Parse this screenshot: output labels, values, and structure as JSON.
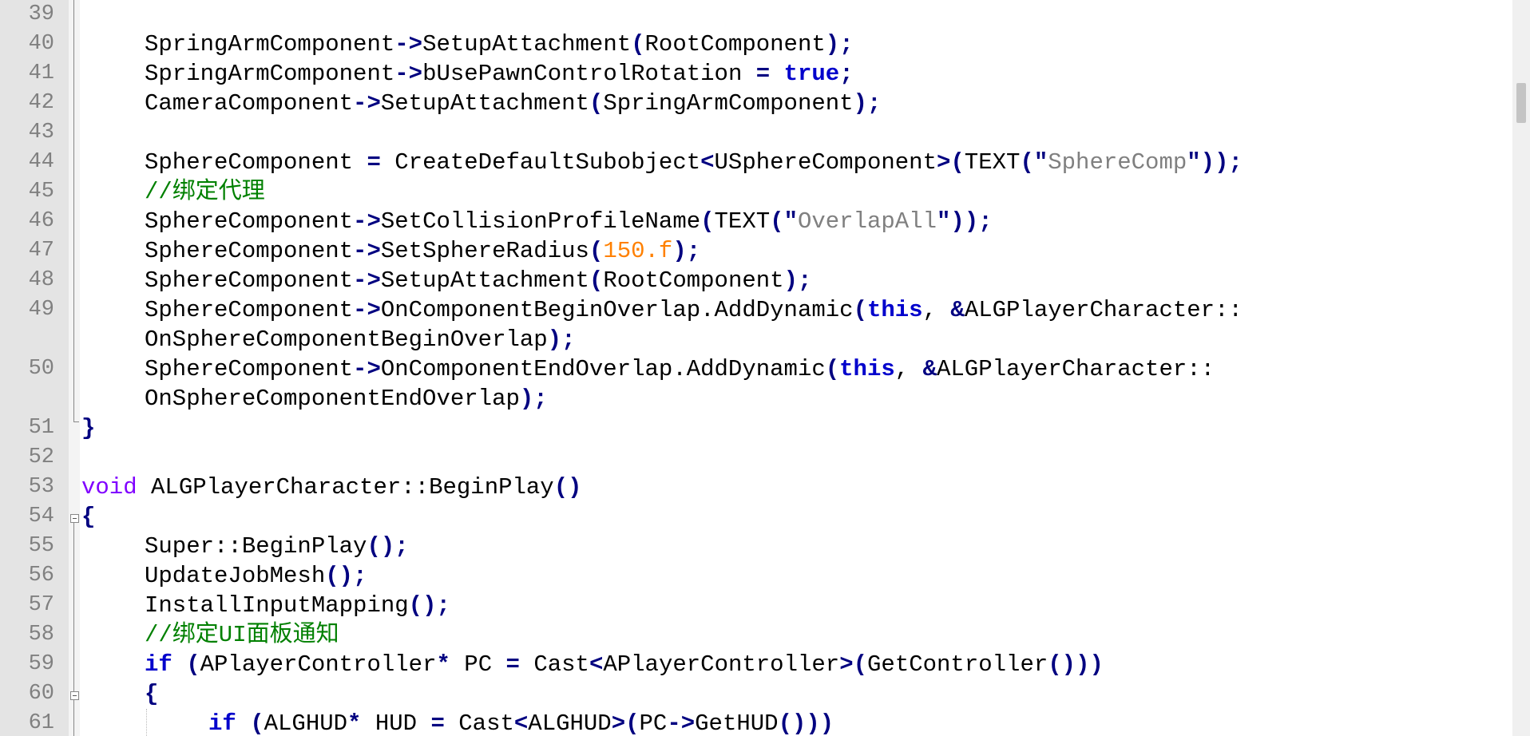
{
  "editor": {
    "lines": [
      {
        "n": "39",
        "text": ""
      },
      {
        "n": "40",
        "text": "SpringArmComponent->SetupAttachment(RootComponent);"
      },
      {
        "n": "41",
        "text": "SpringArmComponent->bUsePawnControlRotation = true;"
      },
      {
        "n": "42",
        "text": "CameraComponent->SetupAttachment(SpringArmComponent);"
      },
      {
        "n": "43",
        "text": ""
      },
      {
        "n": "44",
        "text": "SphereComponent = CreateDefaultSubobject<USphereComponent>(TEXT(\"SphereComp\"));"
      },
      {
        "n": "45",
        "text": "//绑定代理"
      },
      {
        "n": "46",
        "text": "SphereComponent->SetCollisionProfileName(TEXT(\"OverlapAll\"));"
      },
      {
        "n": "47",
        "text": "SphereComponent->SetSphereRadius(150.f);"
      },
      {
        "n": "48",
        "text": "SphereComponent->SetupAttachment(RootComponent);"
      },
      {
        "n": "49",
        "text": "SphereComponent->OnComponentBeginOverlap.AddDynamic(this, &ALGPlayerCharacter::"
      },
      {
        "n": "",
        "text": "OnSphereComponentBeginOverlap);"
      },
      {
        "n": "50",
        "text": "SphereComponent->OnComponentEndOverlap.AddDynamic(this, &ALGPlayerCharacter::"
      },
      {
        "n": "",
        "text": "OnSphereComponentEndOverlap);"
      },
      {
        "n": "51",
        "text": "}"
      },
      {
        "n": "52",
        "text": ""
      },
      {
        "n": "53",
        "text": "void ALGPlayerCharacter::BeginPlay()"
      },
      {
        "n": "54",
        "text": "{"
      },
      {
        "n": "55",
        "text": "Super::BeginPlay();"
      },
      {
        "n": "56",
        "text": "UpdateJobMesh();"
      },
      {
        "n": "57",
        "text": "InstallInputMapping();"
      },
      {
        "n": "58",
        "text": "//绑定UI面板通知"
      },
      {
        "n": "59",
        "text": "if (APlayerController* PC = Cast<APlayerController>(GetController()))"
      },
      {
        "n": "60",
        "text": "{"
      },
      {
        "n": "61",
        "text": "if (ALGHUD* HUD = Cast<ALGHUD>(PC->GetHUD()))"
      }
    ]
  }
}
